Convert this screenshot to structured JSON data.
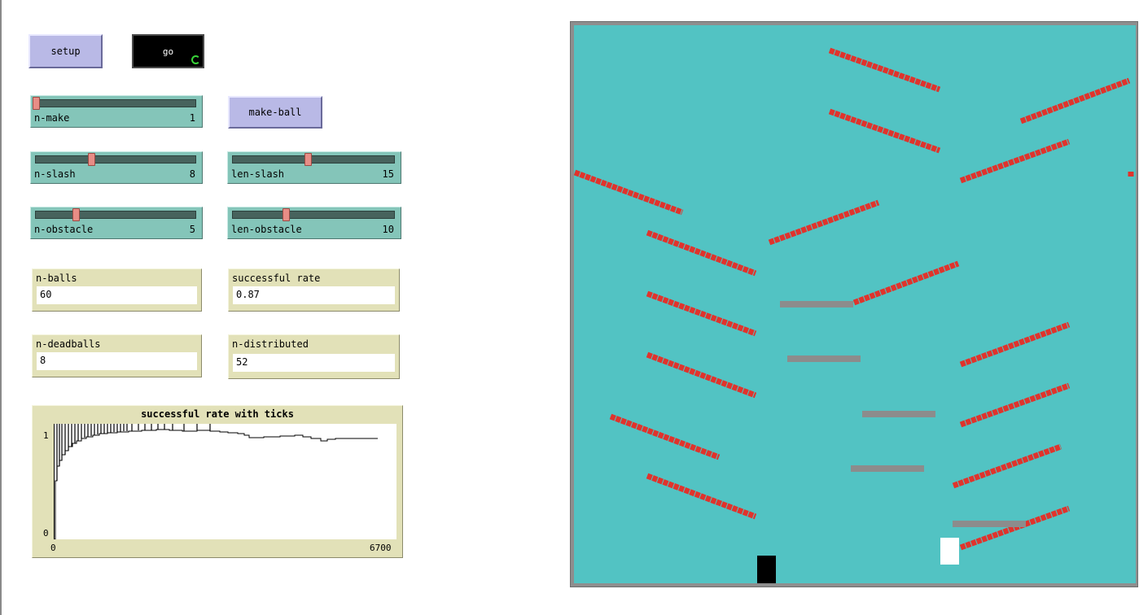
{
  "buttons": {
    "setup": "setup",
    "go": "go",
    "make_ball": "make-ball"
  },
  "sliders": {
    "n_make": {
      "label": "n-make",
      "value": "1",
      "level": 0.0
    },
    "n_slash": {
      "label": "n-slash",
      "value": "8",
      "level": 0.35
    },
    "len_slash": {
      "label": "len-slash",
      "value": "15",
      "level": 0.47
    },
    "n_obstacle": {
      "label": "n-obstacle",
      "value": "5",
      "level": 0.25
    },
    "len_obstacle": {
      "label": "len-obstacle",
      "value": "10",
      "level": 0.33
    }
  },
  "monitors": {
    "n_balls": {
      "label": "n-balls",
      "value": "60"
    },
    "successful_rate": {
      "label": "successful rate",
      "value": "0.87"
    },
    "n_deadballs": {
      "label": "n-deadballs",
      "value": "8"
    },
    "n_distributed": {
      "label": "n-distributed",
      "value": "52"
    }
  },
  "plot": {
    "title": "successful rate with ticks",
    "y_max_label": "1",
    "y_min_label": "0",
    "x_min_label": "0",
    "x_max_label": "6700",
    "colors": {
      "line": "#000000",
      "background": "#ffffff"
    }
  },
  "world": {
    "colors": {
      "background": "#52c3c3",
      "slash": "#e0332c",
      "obstacle": "#8c8c8c",
      "black_bin": "#000000",
      "white_bin": "#ffffff"
    }
  }
}
